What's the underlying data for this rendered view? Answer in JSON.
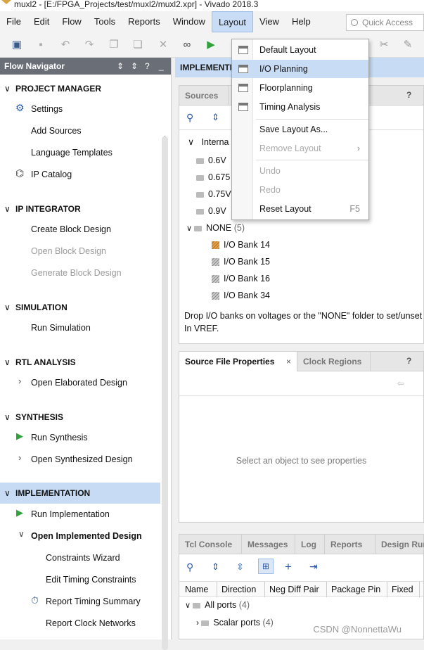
{
  "window": {
    "title": "muxl2 - [E:/FPGA_Projects/test/muxl2/muxl2.xpr] - Vivado 2018.3"
  },
  "menubar": {
    "items": [
      {
        "label": "File"
      },
      {
        "label": "Edit"
      },
      {
        "label": "Flow"
      },
      {
        "label": "Tools"
      },
      {
        "label": "Reports"
      },
      {
        "label": "Window"
      },
      {
        "label": "Layout"
      },
      {
        "label": "View"
      },
      {
        "label": "Help"
      }
    ],
    "active": "Layout",
    "quick_access_placeholder": "Quick Access"
  },
  "layout_menu": {
    "items": [
      {
        "label": "Default Layout",
        "icon": "layout-icon"
      },
      {
        "label": "I/O Planning",
        "icon": "layout-icon",
        "highlighted": true
      },
      {
        "label": "Floorplanning",
        "icon": "layout-icon"
      },
      {
        "label": "Timing Analysis",
        "icon": "layout-icon"
      },
      {
        "label": "Save Layout As..."
      },
      {
        "label": "Remove Layout",
        "disabled": true,
        "submenu": true
      },
      {
        "label": "Undo",
        "disabled": true
      },
      {
        "label": "Redo",
        "disabled": true
      },
      {
        "label": "Reset Layout",
        "shortcut": "F5"
      }
    ],
    "submenu_arrow": "›"
  },
  "flow_navigator": {
    "title": "Flow Navigator",
    "controls": [
      "⇕",
      "⇕",
      "?",
      "_"
    ],
    "sections": [
      {
        "label": "PROJECT MANAGER",
        "items": [
          "Settings",
          "Add Sources",
          "Language Templates",
          "IP Catalog"
        ]
      },
      {
        "label": "IP INTEGRATOR",
        "items": [
          "Create Block Design",
          "Open Block Design",
          "Generate Block Design"
        ],
        "disabled": [
          "Open Block Design",
          "Generate Block Design"
        ]
      },
      {
        "label": "SIMULATION",
        "items": [
          "Run Simulation"
        ]
      },
      {
        "label": "RTL ANALYSIS",
        "items": [
          "Open Elaborated Design"
        ]
      },
      {
        "label": "SYNTHESIS",
        "items": [
          "Run Synthesis",
          "Open Synthesized Design"
        ]
      },
      {
        "label": "IMPLEMENTATION",
        "items": [
          "Run Implementation",
          "Open Implemented Design",
          "Constraints Wizard",
          "Edit Timing Constraints",
          "Report Timing Summary",
          "Report Clock Networks"
        ]
      }
    ]
  },
  "implemented_header": {
    "label": "IMPLEMENTE",
    "suffix": ")"
  },
  "sources_panel": {
    "tab": "Sources",
    "tree_root": "Interna",
    "voltages": [
      "0.6V",
      "0.675",
      "0.75V",
      "0.9V"
    ],
    "none_folder": {
      "label": "NONE",
      "count": "(5)"
    },
    "banks": [
      "I/O Bank 14",
      "I/O Bank 15",
      "I/O Bank 16",
      "I/O Bank 34"
    ],
    "hint": "Drop I/O banks on voltages or the \"NONE\" folder to set/unset In VREF."
  },
  "properties_panel": {
    "tabs": [
      "Source File Properties",
      "Clock Regions"
    ],
    "close": "×",
    "help": "?",
    "empty_text": "Select an object to see properties"
  },
  "console_panel": {
    "tabs": [
      "Tcl Console",
      "Messages",
      "Log",
      "Reports",
      "Design Run"
    ],
    "columns": [
      "Name",
      "Direction",
      "Neg Diff Pair",
      "Package Pin",
      "Fixed"
    ],
    "rows": [
      {
        "label": "All ports",
        "count": "(4)"
      },
      {
        "label": "Scalar ports",
        "count": "(4)"
      }
    ]
  },
  "watermark": "CSDN @NonnettaWu"
}
